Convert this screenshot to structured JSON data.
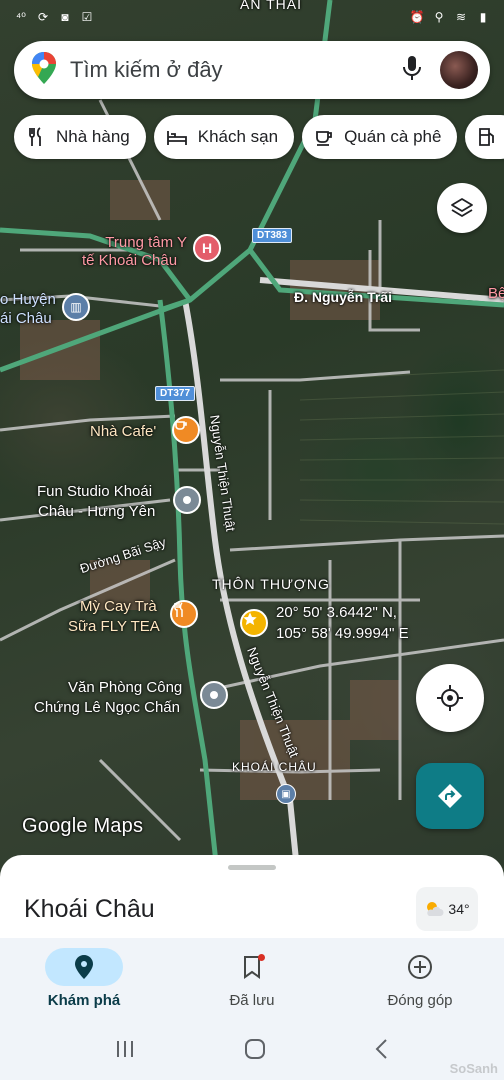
{
  "status_bar": {
    "left_icons": [
      "signal-40-icon",
      "sync-icon",
      "camera-icon",
      "box-icon"
    ],
    "right_icons": [
      "alarm-icon",
      "location-icon",
      "wifi-icon",
      "battery-icon"
    ],
    "top_area_label": "AN THÁI"
  },
  "search": {
    "placeholder": "Tìm kiếm ở đây",
    "mic_icon": "mic-icon",
    "avatar": "profile-avatar"
  },
  "chips": [
    {
      "label": "Nhà hàng",
      "icon": "fork-knife-icon"
    },
    {
      "label": "Khách sạn",
      "icon": "bed-icon"
    },
    {
      "label": "Quán cà phê",
      "icon": "coffee-icon"
    },
    {
      "label": "",
      "icon": "gas-station-icon"
    }
  ],
  "map": {
    "road_labels": {
      "nguyen_trai": "Đ. Nguyễn Trãi",
      "bai_say": "Đường Bãi Sậy",
      "nguyen_thien_thuat_1": "Nguyễn Thiện Thuật",
      "nguyen_thien_thuat_2": "Nguyễn Thiện Thuật"
    },
    "route_shields": {
      "dt383": "DT383",
      "dt377": "DT377"
    },
    "places": {
      "hospital": "Trung tâm Y tế Khoái Châu",
      "hospital_line1": "Trung tâm Y",
      "hospital_line2": "tế Khoái Châu",
      "museum_line1": "o Huyện",
      "museum_line2": "ái Châu",
      "cafe": "Nhà Cafe'",
      "studio_line1": "Fun Studio Khoái",
      "studio_line2": "Châu - Hưng Yên",
      "restaurant_line1": "Mỳ Cay Trà",
      "restaurant_line2": "Sữa FLY TEA",
      "notary_line1": "Văn Phòng Công",
      "notary_line2": "Chứng Lê Ngọc Chấn",
      "right_edge": "Bệ"
    },
    "areas": {
      "thon_thuong": "THÔN THƯỢNG",
      "khoai_chau": "KHOÁI CHÂU"
    },
    "coordinates": {
      "lat": "20° 50' 3.6442\" N,",
      "lng": "105° 58' 49.9994\" E"
    },
    "logo_text": "Google Maps"
  },
  "buttons": {
    "layers": "layers-icon",
    "locate": "my-location-icon",
    "directions": "directions-icon"
  },
  "sheet": {
    "title": "Khoái Châu",
    "weather": "34°",
    "weather_icon": "partly-cloudy-icon"
  },
  "nav": [
    {
      "label": "Khám phá",
      "icon": "explore-pin-icon",
      "active": true
    },
    {
      "label": "Đã lưu",
      "icon": "bookmark-icon",
      "active": false
    },
    {
      "label": "Đóng góp",
      "icon": "add-circle-icon",
      "active": false
    }
  ],
  "watermark": "SoSanh",
  "colors": {
    "accent": "#0e7c86",
    "active_nav": "#c2e7ff",
    "road_green": "#4fa77a",
    "hospital": "#e35d6a",
    "food": "#f08a24",
    "cafe": "#f08a24"
  }
}
